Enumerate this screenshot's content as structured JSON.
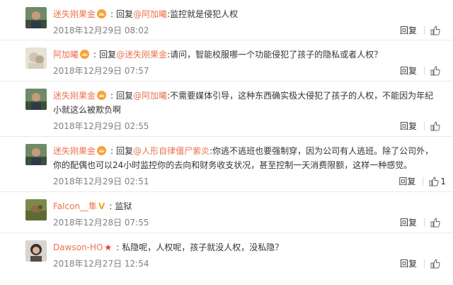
{
  "ui": {
    "reply_label": "回复",
    "reply_prefix": "回复"
  },
  "comments": [
    {
      "user": "迷失刚果金",
      "badge": "crown",
      "reply_to": "@阿加曦",
      "text": ":监控就是侵犯人权",
      "time": "2018年12月29日 08:02",
      "likes": ""
    },
    {
      "user": "阿加曦",
      "badge": "crown",
      "reply_to": "@迷失刚果金",
      "text": ":请问，智能校服哪一个功能侵犯了孩子的隐私或者人权？",
      "time": "2018年12月29日 07:57",
      "likes": ""
    },
    {
      "user": "迷失刚果金",
      "badge": "crown",
      "reply_to": "@阿加曦",
      "text": ":不需要媒体引导，这种东西确实极大侵犯了孩子的人权，不能因为年纪小就这么被欺负啊",
      "time": "2018年12月29日 02:55",
      "likes": ""
    },
    {
      "user": "迷失刚果金",
      "badge": "crown",
      "reply_to": "@人形自律僵尸紫炎",
      "text": ":你逃不逃班也要强制穿，因为公司有人逃班。除了公司外，你的配偶也可以24小时监控你的去向和财务收支状况，甚至控制一天消费限额，这样一种感觉。",
      "time": "2018年12月29日 02:51",
      "likes": "1"
    },
    {
      "user": "Falcon__隼",
      "badge": "v",
      "reply_to": "",
      "text": "监狱",
      "time": "2018年12月28日 07:55",
      "likes": ""
    },
    {
      "user": "Dawson-HO",
      "badge": "star",
      "reply_to": "",
      "text": "私隐呢，人权呢，孩子就没人权，没私隐？",
      "time": "2018年12月27日 12:54",
      "likes": ""
    }
  ],
  "icons": {
    "crown": "crown-badge-icon",
    "v": "v-badge-icon",
    "star": "star-badge-icon",
    "like": "thumbs-up-icon"
  },
  "colors": {
    "username": "#eb7350",
    "time": "#808080",
    "badge_orange": "#f7a13a",
    "star_red": "#e23a2e"
  }
}
